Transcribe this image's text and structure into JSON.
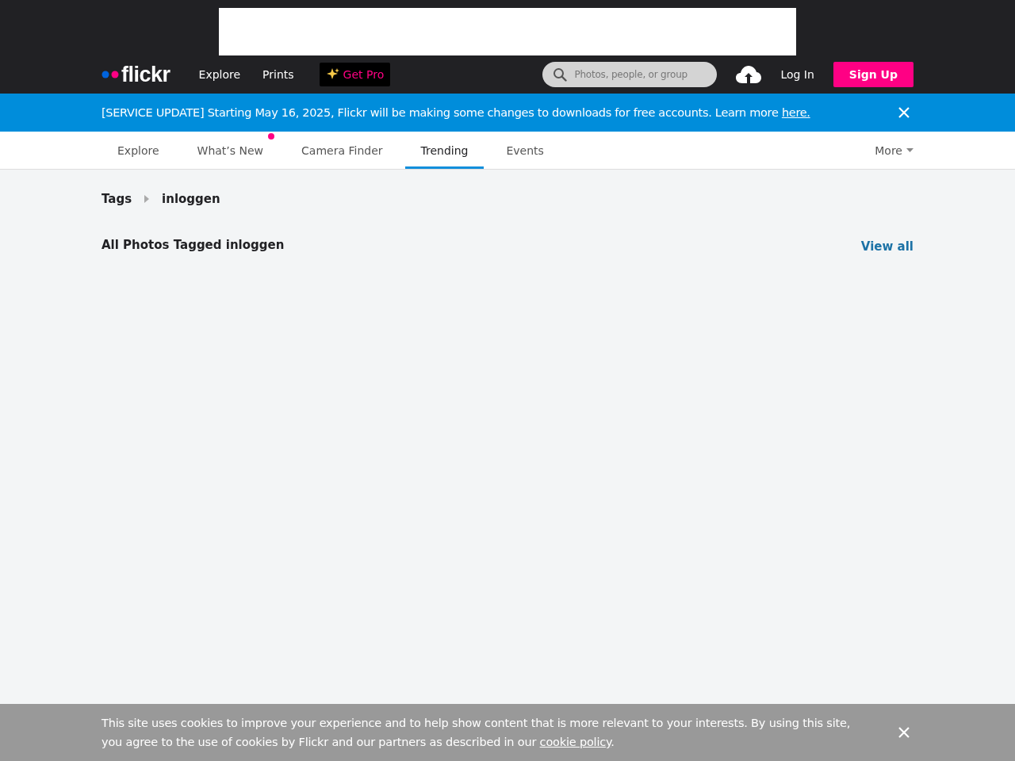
{
  "header": {
    "logo": "flickr",
    "nav": [
      "Explore",
      "Prints"
    ],
    "get_pro": "Get Pro",
    "search": {
      "placeholder": "Photos, people, or group"
    },
    "login": "Log In",
    "signup": "Sign Up"
  },
  "banner": {
    "text": "[SERVICE UPDATE] Starting May 16, 2025, Flickr will be making some changes to downloads for free accounts. Learn more ",
    "link": "here."
  },
  "tabs": [
    {
      "label": "Explore",
      "selected": false,
      "dot": false
    },
    {
      "label": "What’s New",
      "selected": false,
      "dot": true
    },
    {
      "label": "Camera Finder",
      "selected": false,
      "dot": false
    },
    {
      "label": "Trending",
      "selected": true,
      "dot": false
    },
    {
      "label": "Events",
      "selected": false,
      "dot": false
    }
  ],
  "more": "More",
  "breadcrumb": [
    "Tags",
    "inloggen"
  ],
  "section": {
    "title": "All Photos Tagged inloggen",
    "view_all": "View all"
  },
  "cookie": {
    "text": "This site uses cookies to improve your experience and to help show content that is more relevant to your interests. By using this site, you agree to the use of cookies by Flickr and our partners as described in our ",
    "link": "cookie policy",
    "after": "."
  }
}
